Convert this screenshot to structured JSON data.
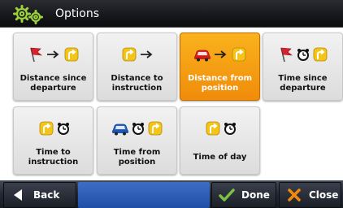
{
  "header": {
    "title": "Options",
    "icon": "gears-icon"
  },
  "options": [
    {
      "label": "Distance since departure",
      "icons": [
        "flag-icon",
        "arrow-right-icon",
        "turn-sign-icon"
      ],
      "selected": false
    },
    {
      "label": "Distance to instruction",
      "icons": [
        "turn-sign-icon",
        "arrow-right-icon"
      ],
      "selected": false
    },
    {
      "label": "Distance from position",
      "icons": [
        "car-icon",
        "arrow-right-icon",
        "turn-sign-icon"
      ],
      "selected": true
    },
    {
      "label": "Time since departure",
      "icons": [
        "flag-icon",
        "clock-icon",
        "turn-sign-icon"
      ],
      "selected": false
    },
    {
      "label": "Time to instruction",
      "icons": [
        "turn-sign-icon",
        "clock-icon"
      ],
      "selected": false
    },
    {
      "label": "Time from position",
      "icons": [
        "car-icon",
        "clock-icon",
        "turn-sign-icon"
      ],
      "selected": false
    },
    {
      "label": "Time of day",
      "icons": [
        "turn-sign-icon",
        "clock-icon"
      ],
      "selected": false
    }
  ],
  "footer": {
    "back_label": "Back",
    "done_label": "Done",
    "close_label": "Close"
  },
  "colors": {
    "selected_tile": "#f59f14",
    "done_check": "#7bc242",
    "close_x": "#f08a0a",
    "bar_blue": "#2b5cb5"
  }
}
